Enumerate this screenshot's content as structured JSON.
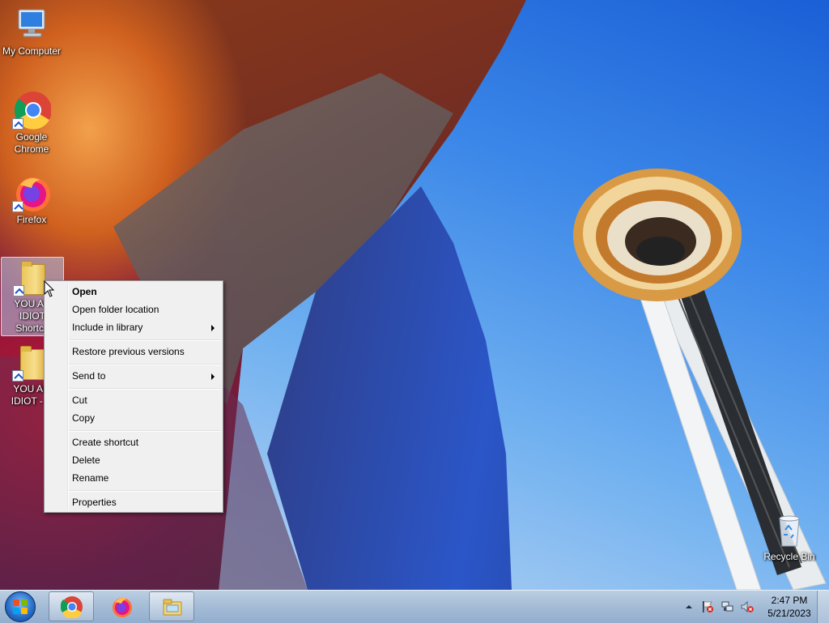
{
  "desktop": {
    "icons": [
      {
        "label": "My Computer",
        "icon": "computer-icon"
      },
      {
        "label": "Google\nChrome",
        "icon": "chrome-icon"
      },
      {
        "label": "Firefox",
        "icon": "firefox-icon"
      },
      {
        "label": "YOU AR\nIDIOT\nShortcu",
        "icon": "folder-icon"
      },
      {
        "label": "YOU AR\nIDIOT - S",
        "icon": "folder-icon"
      },
      {
        "label": "Recycle Bin",
        "icon": "recycle-bin-icon"
      }
    ]
  },
  "context_menu": {
    "items": {
      "open": "Open",
      "open_folder_location": "Open folder location",
      "include_in_library": "Include in library",
      "restore_previous_versions": "Restore previous versions",
      "send_to": "Send to",
      "cut": "Cut",
      "copy": "Copy",
      "create_shortcut": "Create shortcut",
      "delete": "Delete",
      "rename": "Rename",
      "properties": "Properties"
    }
  },
  "taskbar": {
    "start_icon": "windows-logo-icon",
    "pinned": [
      "chrome-icon",
      "firefox-icon",
      "file-explorer-icon"
    ],
    "tray_icons": [
      "show-hidden-icons-chevron",
      "action-center-flag-icon",
      "network-icon",
      "volume-muted-icon"
    ],
    "clock": {
      "time": "2:47 PM",
      "date": "5/21/2023"
    }
  },
  "colors": {
    "menu_bg": "#f0f0f0",
    "taskbar_tint": "#aac3de",
    "selection": "#b4cdeb"
  }
}
